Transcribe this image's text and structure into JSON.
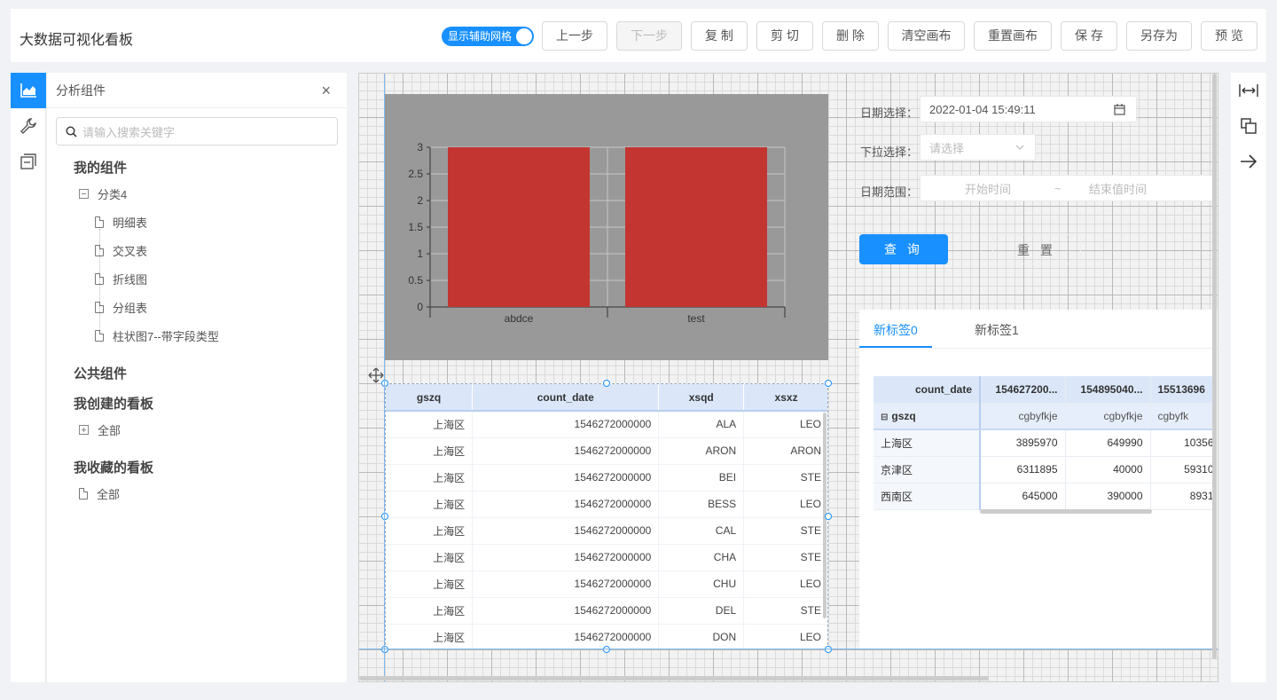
{
  "header": {
    "title": "大数据可视化看板",
    "grid_toggle_label": "显示辅助网格",
    "buttons": [
      "上一步",
      "下一步",
      "复 制",
      "剪 切",
      "删 除",
      "清空画布",
      "重置画布",
      "保 存",
      "另存为",
      "预 览"
    ]
  },
  "left_panel": {
    "title": "分析组件",
    "search_placeholder": "请输入搜索关键字",
    "my_components": "我的组件",
    "category": "分类4",
    "items": [
      "明细表",
      "交叉表",
      "折线图",
      "分组表",
      "柱状图7--带字段类型"
    ],
    "public_components": "公共组件",
    "created_boards": "我创建的看板",
    "created_all": "全部",
    "fav_boards": "我收藏的看板",
    "fav_all": "全部"
  },
  "chart_data": {
    "type": "bar",
    "categories": [
      "abdce",
      "test"
    ],
    "values": [
      3,
      3
    ],
    "ylim": [
      0,
      3
    ],
    "yticks": [
      "0",
      "0.5",
      "1",
      "1.5",
      "2",
      "2.5",
      "3"
    ],
    "bar_color": "#c23531"
  },
  "filters": {
    "date_label": "日期选择：",
    "date_value": "2022-01-04 15:49:11",
    "select_label": "下拉选择：",
    "select_placeholder": "请选择",
    "range_label": "日期范围：",
    "range_start": "开始时间",
    "range_sep": "~",
    "range_end": "结束值时间",
    "query_button": "查 询",
    "reset_button": "重 置"
  },
  "tabs": [
    "新标签0",
    "新标签1"
  ],
  "pivot": {
    "corner_col": "count_date",
    "corner_row": "gszq",
    "col_headers": [
      "154627200...",
      "154895040...",
      "15513696"
    ],
    "sub_headers": [
      "cgbyfkje",
      "cgbyfkje",
      "cgbyfk"
    ],
    "rows": [
      {
        "label": "上海区",
        "values": [
          "3895970",
          "649990",
          "10356"
        ]
      },
      {
        "label": "京津区",
        "values": [
          "6311895",
          "40000",
          "59310"
        ]
      },
      {
        "label": "西南区",
        "values": [
          "645000",
          "390000",
          "8931"
        ]
      }
    ]
  },
  "detail_table": {
    "columns": [
      "gszq",
      "count_date",
      "xsqd",
      "xsxz"
    ],
    "rows": [
      [
        "上海区",
        "1546272000000",
        "ALA",
        "LEO"
      ],
      [
        "上海区",
        "1546272000000",
        "ARON",
        "ARON"
      ],
      [
        "上海区",
        "1546272000000",
        "BEI",
        "STE"
      ],
      [
        "上海区",
        "1546272000000",
        "BESS",
        "LEO"
      ],
      [
        "上海区",
        "1546272000000",
        "CAL",
        "STE"
      ],
      [
        "上海区",
        "1546272000000",
        "CHA",
        "STE"
      ],
      [
        "上海区",
        "1546272000000",
        "CHU",
        "LEO"
      ],
      [
        "上海区",
        "1546272000000",
        "DEL",
        "STE"
      ],
      [
        "上海区",
        "1546272000000",
        "DON",
        "LEO"
      ]
    ]
  }
}
